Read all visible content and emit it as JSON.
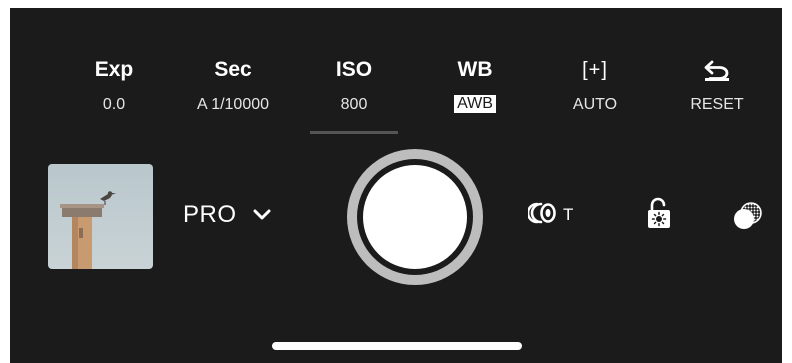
{
  "controls": {
    "exp": {
      "label": "Exp",
      "value": "0.0"
    },
    "sec": {
      "label": "Sec",
      "value": "A 1/10000"
    },
    "iso": {
      "label": "ISO",
      "value": "800"
    },
    "wb": {
      "label": "WB",
      "value": "AWB"
    },
    "focus": {
      "icon": "focus-bracket-icon",
      "label": "[+]",
      "value": "AUTO"
    },
    "reset": {
      "icon": "reset-arrow-icon",
      "value": "RESET"
    }
  },
  "active_control": "ISO",
  "mode": {
    "label": "PRO",
    "icon": "chevron-down-icon"
  },
  "lens": {
    "icon": "lens-switch-icon",
    "label": "T"
  },
  "icons": {
    "lock": "exposure-lock-icon",
    "filter": "filter-icon",
    "shutter": "shutter-button"
  },
  "colors": {
    "background": "#1b1b1b",
    "text": "#ffffff",
    "shutter_ring": "#bdbdbd"
  }
}
